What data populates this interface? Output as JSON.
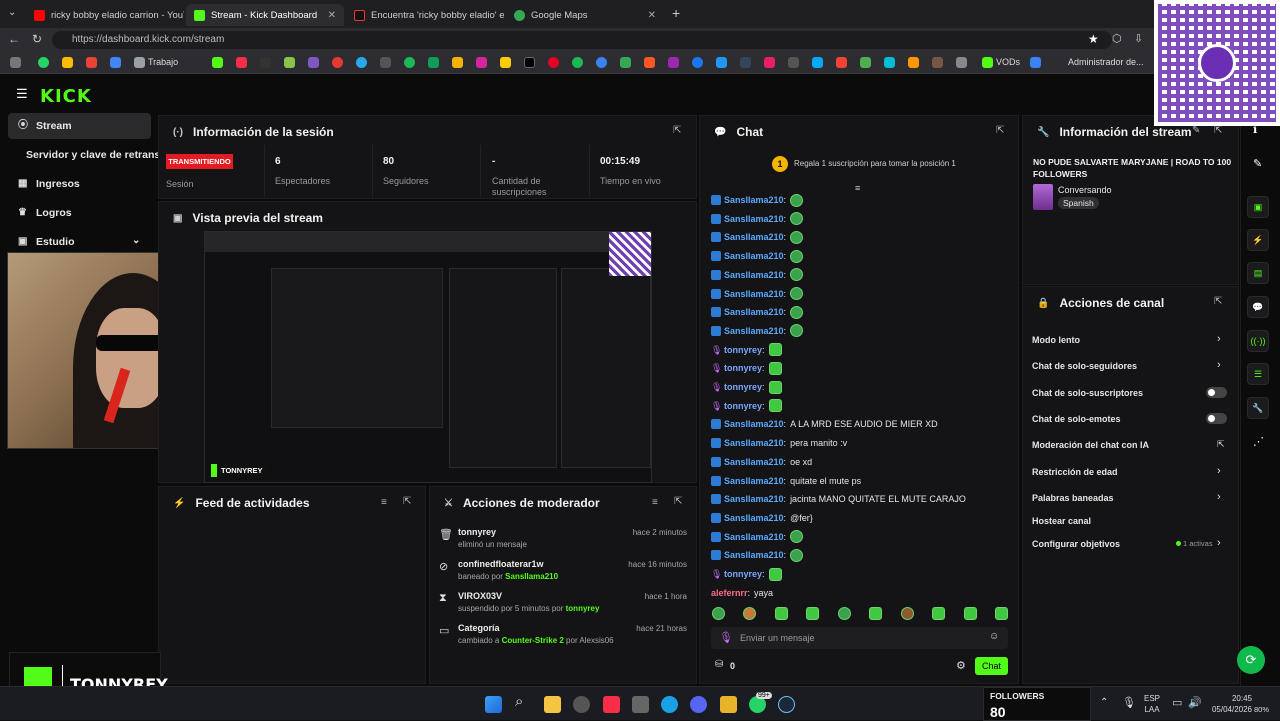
{
  "browser": {
    "tabs": [
      {
        "label": "ricky bobby eladio carrion - YouTu",
        "active": false
      },
      {
        "label": "Stream - Kick Dashboard",
        "active": true
      },
      {
        "label": "Encuentra 'ricky bobby eladio' en",
        "active": false
      },
      {
        "label": "Google Maps",
        "active": false
      }
    ],
    "url": "https://dashboard.kick.com/stream",
    "bookmarks": [
      "Trabajo",
      "VODs",
      "Administrador de..."
    ]
  },
  "app": {
    "logo": "KICK",
    "sidebar": [
      {
        "label": "Stream",
        "icon": "broadcast-icon",
        "active": true
      },
      {
        "label": "Servidor y clave de retransm",
        "icon": "",
        "active": false
      },
      {
        "label": "Ingresos",
        "icon": "dollar-icon",
        "active": false
      },
      {
        "label": "Logros",
        "icon": "trophy-icon",
        "active": false
      },
      {
        "label": "Estudio",
        "icon": "studio-icon",
        "active": false
      }
    ]
  },
  "session": {
    "title": "Información de la sesión",
    "status_badge": "TRANSMITIENDO",
    "stats": [
      {
        "value": "",
        "label": "Sesión"
      },
      {
        "value": "6",
        "label": "Espectadores"
      },
      {
        "value": "80",
        "label": "Seguidores"
      },
      {
        "value": "-",
        "label": "Cantidad de suscripciones"
      },
      {
        "value": "00:15:49",
        "label": "Tiempo en vivo"
      }
    ]
  },
  "preview": {
    "title": "Vista previa del stream",
    "overlay_name": "TONNYREY"
  },
  "activity": {
    "title": "Feed de actividades"
  },
  "mod_actions": {
    "title": "Acciones de moderador",
    "items": [
      {
        "user": "tonnyrey",
        "desc": "eliminó un mensaje",
        "highlight": "",
        "suffix": "",
        "time": "hace 2 minutos",
        "icon": "trash-icon"
      },
      {
        "user": "confinedfloaterar1w",
        "desc": "baneado por ",
        "highlight": "Sansllama210",
        "suffix": "",
        "time": "hace 16 minutos",
        "icon": "ban-icon"
      },
      {
        "user": "VIROX03V",
        "desc": "suspendido por 5 minutos por ",
        "highlight": "tonnyrey",
        "suffix": "",
        "time": "hace 1 hora",
        "icon": "hourglass-icon"
      },
      {
        "user": "Categoría",
        "desc": "cambiado a ",
        "highlight": "Counter-Strike 2",
        "suffix": " por Alexsis06",
        "time": "hace 21 horas",
        "icon": "category-icon"
      }
    ]
  },
  "chat": {
    "title": "Chat",
    "gift_text": "Regala 1 suscripción para tomar la posición 1",
    "gift_rank": "1",
    "messages": [
      {
        "user": "Sansllama210",
        "text": "",
        "emote": true,
        "badge": "blue",
        "color": "blue"
      },
      {
        "user": "Sansllama210",
        "text": "",
        "emote": true,
        "badge": "blue",
        "color": "blue"
      },
      {
        "user": "Sansllama210",
        "text": "",
        "emote": true,
        "badge": "blue",
        "color": "blue"
      },
      {
        "user": "Sansllama210",
        "text": "",
        "emote": true,
        "badge": "blue",
        "color": "blue"
      },
      {
        "user": "Sansllama210",
        "text": "",
        "emote": true,
        "badge": "blue",
        "color": "blue"
      },
      {
        "user": "Sansllama210",
        "text": "",
        "emote": true,
        "badge": "blue",
        "color": "blue"
      },
      {
        "user": "Sansllama210",
        "text": "",
        "emote": true,
        "badge": "blue",
        "color": "blue"
      },
      {
        "user": "Sansllama210",
        "text": "",
        "emote": true,
        "badge": "blue",
        "color": "blue"
      },
      {
        "user": "tonnyrey",
        "text": "",
        "emote": true,
        "badge": "mic",
        "color": "purple"
      },
      {
        "user": "tonnyrey",
        "text": "",
        "emote": true,
        "badge": "mic",
        "color": "purple"
      },
      {
        "user": "tonnyrey",
        "text": "",
        "emote": true,
        "badge": "mic",
        "color": "purple"
      },
      {
        "user": "tonnyrey",
        "text": "",
        "emote": true,
        "badge": "mic",
        "color": "purple"
      },
      {
        "user": "Sansllama210",
        "text": "A LA MRD ESE AUDIO DE MIER XD",
        "emote": false,
        "badge": "blue",
        "color": "blue"
      },
      {
        "user": "Sansllama210",
        "text": "pera manito :v",
        "emote": false,
        "badge": "blue",
        "color": "blue"
      },
      {
        "user": "Sansllama210",
        "text": "oe xd",
        "emote": false,
        "badge": "blue",
        "color": "blue"
      },
      {
        "user": "Sansllama210",
        "text": "quitate el mute ps",
        "emote": false,
        "badge": "blue",
        "color": "blue"
      },
      {
        "user": "Sansllama210",
        "text": "jacinta MANO QUITATE EL MUTE CARAJO",
        "emote": false,
        "badge": "blue",
        "color": "blue"
      },
      {
        "user": "Sansllama210",
        "text": "@fer}",
        "emote": false,
        "badge": "blue",
        "color": "blue"
      },
      {
        "user": "Sansllama210",
        "text": "",
        "emote": true,
        "badge": "blue",
        "color": "blue"
      },
      {
        "user": "Sansllama210",
        "text": "",
        "emote": true,
        "badge": "blue",
        "color": "blue"
      },
      {
        "user": "tonnyrey",
        "text": "",
        "emote": true,
        "badge": "mic",
        "color": "purple"
      },
      {
        "user": "alefernrr",
        "text": "yaya",
        "emote": false,
        "badge": "none",
        "color": "pink"
      }
    ],
    "input_placeholder": "Enviar un mensaje",
    "points": "0",
    "send_label": "Chat"
  },
  "stream_info": {
    "title": "Información del stream",
    "stream_title": "NO PUDE SALVARTE MARYJANE | ROAD TO 100 FOLLOWERS",
    "category": "Conversando",
    "language": "Spanish"
  },
  "channel_actions": {
    "title": "Acciones de canal",
    "items": [
      {
        "label": "Modo lento",
        "control": "chevron"
      },
      {
        "label": "Chat de solo-seguidores",
        "control": "chevron"
      },
      {
        "label": "Chat de solo-suscriptores",
        "control": "toggle"
      },
      {
        "label": "Chat de solo-emotes",
        "control": "toggle"
      },
      {
        "label": "Moderación del chat con IA",
        "control": "external"
      },
      {
        "label": "Restricción de edad",
        "control": "chevron"
      },
      {
        "label": "Palabras baneadas",
        "control": "chevron"
      },
      {
        "label": "Hostear canal",
        "control": "none"
      },
      {
        "label": "Configurar objetivos",
        "control": "chevron"
      }
    ],
    "goals_active": "1 activas"
  },
  "overlay": {
    "brand": "TONNYREY",
    "followers_label": "FOLLOWERS",
    "followers_value": "80"
  },
  "taskbar": {
    "lang": "ESP",
    "lang2": "LAA",
    "time": "20:45",
    "date": "05/04/2026",
    "battery": "80%",
    "notif": "99+"
  },
  "colors": {
    "kick_green": "#53fc18",
    "live_red": "#e41b23",
    "link_blue": "#5aa9ff"
  }
}
